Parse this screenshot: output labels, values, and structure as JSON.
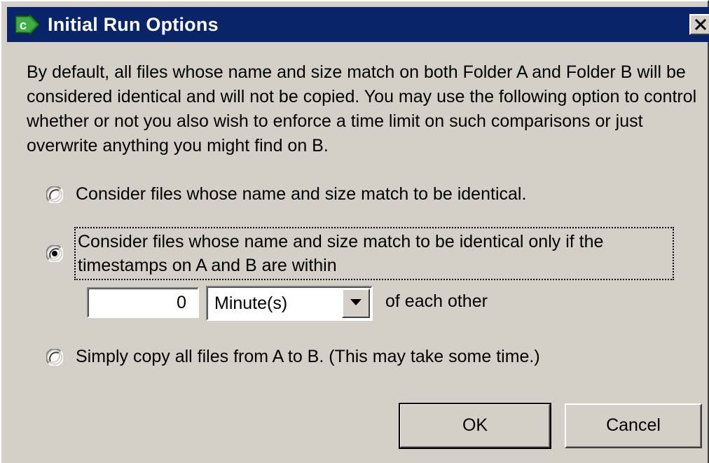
{
  "window": {
    "title": "Initial Run Options",
    "icon": "app-c-arrow-icon",
    "close_icon": "close-x-icon",
    "title_bar_color": "#0a246a"
  },
  "description": "By default, all files whose name and size match on both Folder A and Folder B will be considered identical and will not be copied. You may use the following option to control whether or not you also wish to enforce a time limit on such comparisons or just overwrite anything you might find on B.",
  "options": [
    {
      "label": "Consider files whose name and size match to be identical.",
      "selected": false
    },
    {
      "label_line1": "Consider files whose name and size match to be identical only if the",
      "label_line2": "timestamps on A and B are within",
      "selected": true
    },
    {
      "label": "Simply copy all files from A to B. (This may take some time.)",
      "selected": false
    }
  ],
  "time_window": {
    "value": "0",
    "unit": "Minute(s)",
    "suffix": "of each other"
  },
  "buttons": {
    "ok": "OK",
    "cancel": "Cancel"
  }
}
